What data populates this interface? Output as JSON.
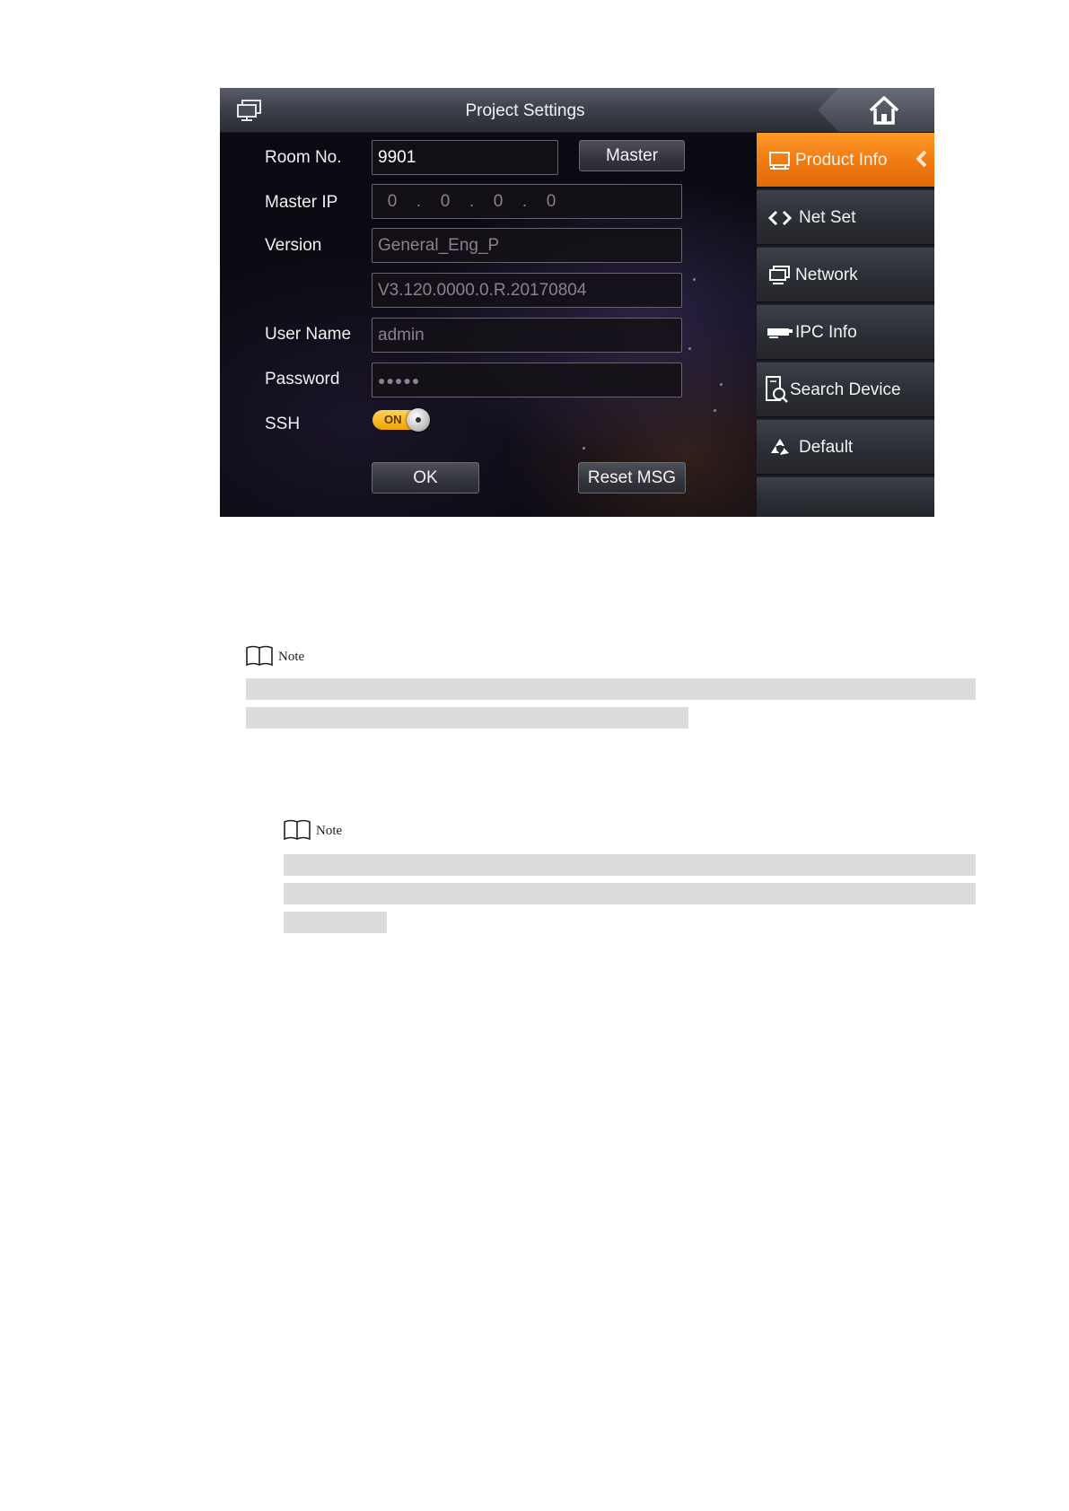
{
  "device": {
    "title": "Project Settings",
    "form": {
      "room_no_label": "Room No.",
      "room_no_value": "9901",
      "master_button": "Master",
      "master_ip_label": "Master IP",
      "master_ip": [
        "0",
        "0",
        "0",
        "0"
      ],
      "ip_separator": ".",
      "version_label": "Version",
      "version_value_1": "General_Eng_P",
      "version_value_2": "V3.120.0000.0.R.20170804",
      "username_label": "User Name",
      "username_value": "admin",
      "password_label": "Password",
      "password_value": "●●●●●",
      "ssh_label": "SSH",
      "ssh_toggle_text": "ON",
      "ssh_enabled": true,
      "ok_button": "OK",
      "reset_button": "Reset MSG"
    },
    "sidebar": {
      "items": [
        {
          "label": "Product Info",
          "icon": "product-info-icon",
          "active": true
        },
        {
          "label": "Net Set",
          "icon": "net-set-icon",
          "active": false
        },
        {
          "label": "Network",
          "icon": "network-icon",
          "active": false
        },
        {
          "label": "IPC Info",
          "icon": "ipc-camera-icon",
          "active": false
        },
        {
          "label": "Search Device",
          "icon": "search-device-icon",
          "active": false
        },
        {
          "label": "Default",
          "icon": "recycle-icon",
          "active": false
        }
      ]
    },
    "colors": {
      "accent": "#ef7a12",
      "toggle_on": "#f3a400"
    }
  },
  "notes": [
    {
      "label": "Note"
    },
    {
      "label": "Note"
    }
  ]
}
